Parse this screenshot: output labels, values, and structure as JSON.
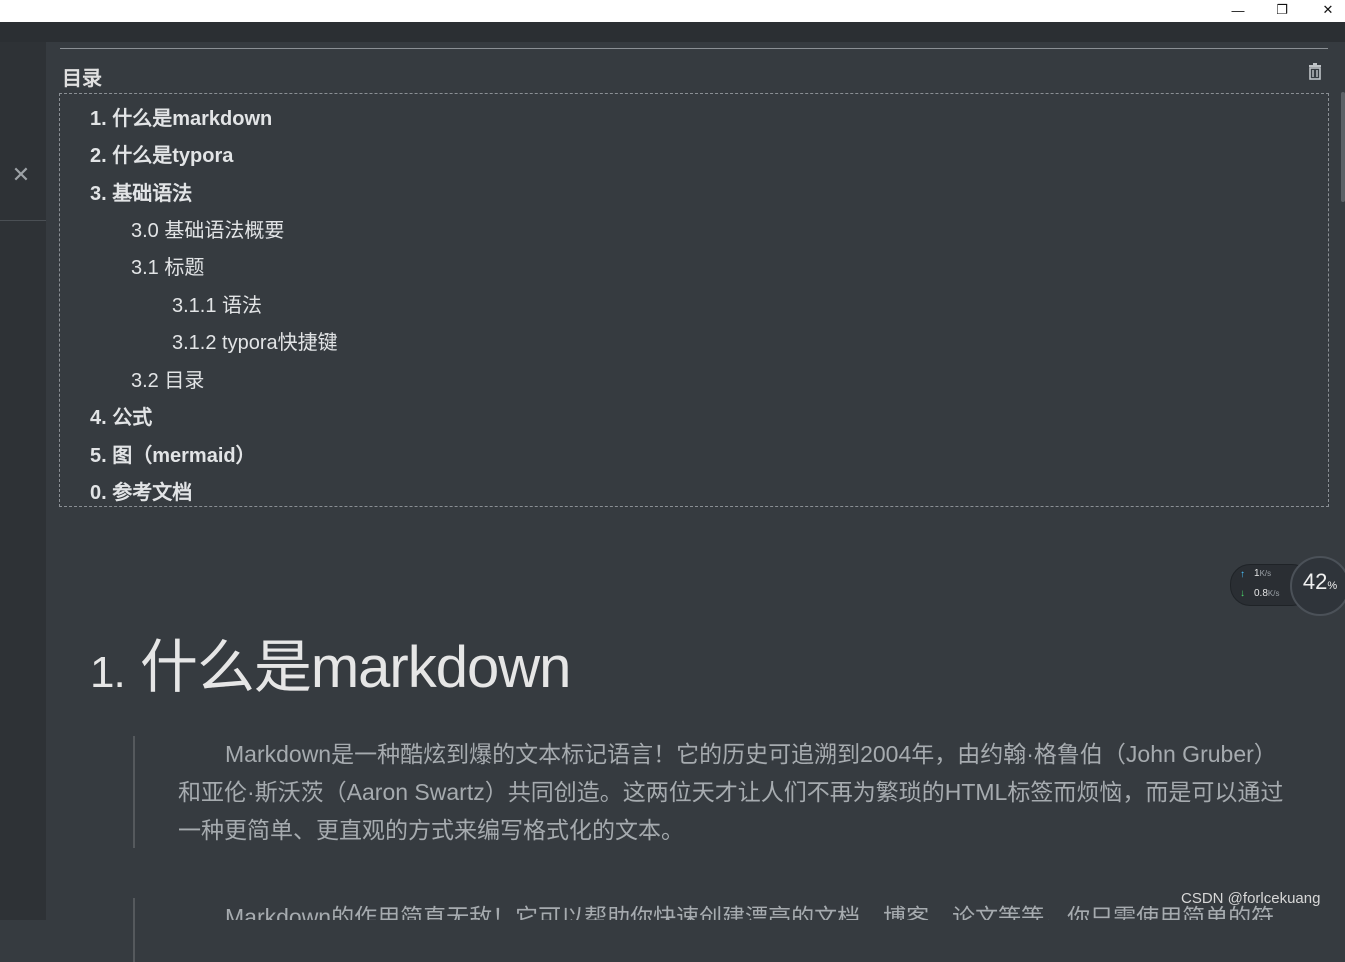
{
  "window": {
    "min_glyph": "—",
    "max_glyph": "❐",
    "close_glyph": "✕"
  },
  "sidebar": {
    "close_glyph": "✕"
  },
  "toc": {
    "title": "目录",
    "items": [
      {
        "text": "1. 什么是markdown",
        "level": 1
      },
      {
        "text": "2. 什么是typora",
        "level": 1
      },
      {
        "text": "3. 基础语法",
        "level": 1
      },
      {
        "text": "3.0 基础语法概要",
        "level": 2
      },
      {
        "text": "3.1 标题",
        "level": 2
      },
      {
        "text": "3.1.1 语法",
        "level": 3
      },
      {
        "text": "3.1.2 typora快捷键",
        "level": 3
      },
      {
        "text": "3.2 目录",
        "level": 2
      },
      {
        "text": "4. 公式",
        "level": 1
      },
      {
        "text": "5. 图（mermaid）",
        "level": 1
      },
      {
        "text": "0. 参考文档",
        "level": 1
      }
    ]
  },
  "heading": {
    "num": "1.",
    "text": "什么是markdown"
  },
  "quote1": "Markdown是一种酷炫到爆的文本标记语言！它的历史可追溯到2004年，由约翰·格鲁伯（John Gruber）和亚伦·斯沃茨（Aaron Swartz）共同创造。这两位天才让人们不再为繁琐的HTML标签而烦恼，而是可以通过一种更简单、更直观的方式来编写格式化的文本。",
  "quote2": "Markdown的作用简直无敌！它可以帮助你快速创建漂亮的文档、博客、论文等等。你只需使用简单的符",
  "netmon": {
    "up_value": "1",
    "up_unit": "K/s",
    "down_value": "0.8",
    "down_unit": "K/s",
    "cpu_value": "42",
    "cpu_unit": "%"
  },
  "watermark": "CSDN @forlcekuang",
  "colors": {
    "background": "#363B40",
    "text": "#E2E4E6",
    "quote": "#A6ABAF"
  }
}
